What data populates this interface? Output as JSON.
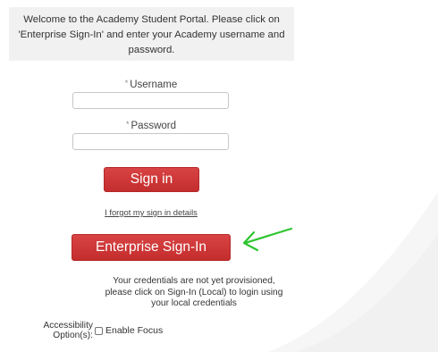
{
  "welcome": {
    "lines": [
      "Welcome to the Academy Student Portal. Please click on",
      "'Enterprise Sign-In' and enter your Academy username and",
      "password."
    ]
  },
  "form": {
    "required_marker": "*",
    "username_label": "Username",
    "username_value": "",
    "password_label": "Password",
    "password_value": "",
    "sign_in_label": "Sign in",
    "forgot_link": "I forgot my sign in details",
    "enterprise_label": "Enterprise Sign-In"
  },
  "annotation": {
    "arrow_color": "#2ec52e",
    "arrow_icon": "green-arrow-icon"
  },
  "message": {
    "lines": [
      "Your credentials are not yet provisioned,",
      "please click on Sign-In (Local) to login using",
      "your local credentials"
    ]
  },
  "accessibility": {
    "label_line1": "Accessibility",
    "label_line2": "Option(s):",
    "enable_focus_label": "Enable Focus",
    "enable_focus_checked": false
  },
  "colors": {
    "button_red": "#c9302c",
    "welcome_bg": "#f1f1f1"
  }
}
